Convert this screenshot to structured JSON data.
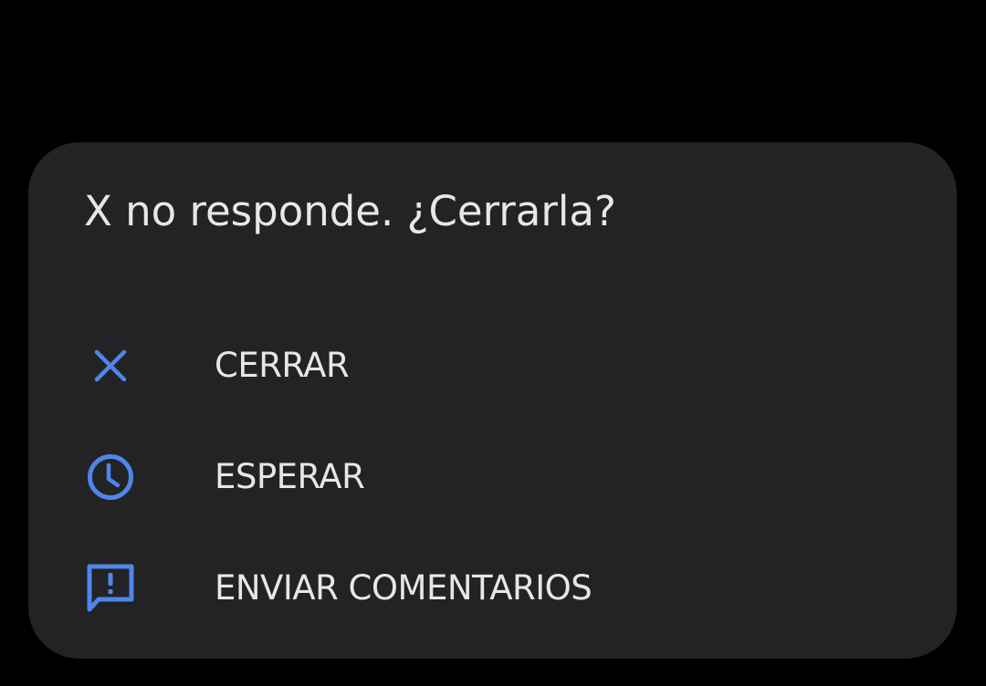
{
  "accent_color": "#4f86ea",
  "dialog": {
    "title": "X no responde. ¿Cerrarla?",
    "options": [
      {
        "label": "CERRAR",
        "icon": "close-icon"
      },
      {
        "label": "ESPERAR",
        "icon": "clock-icon"
      },
      {
        "label": "ENVIAR COMENTARIOS",
        "icon": "feedback-icon"
      }
    ]
  }
}
